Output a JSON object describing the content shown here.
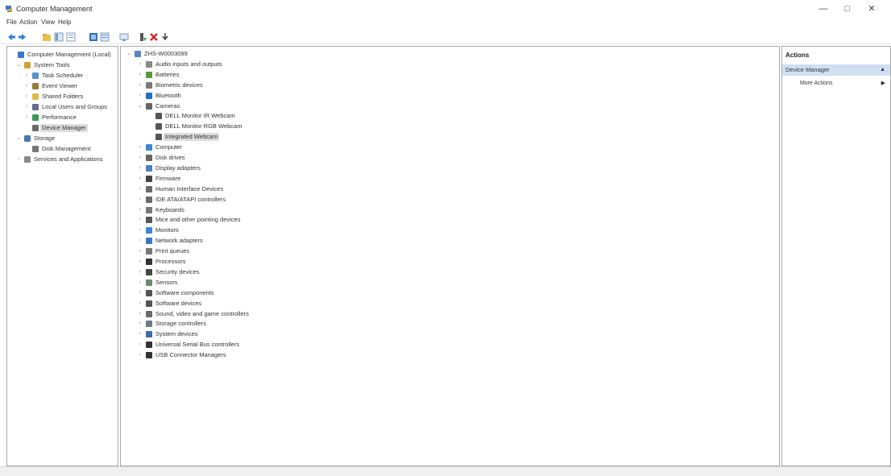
{
  "window": {
    "title": "Computer Management",
    "minimize": "—",
    "maximize": "□",
    "close": "✕"
  },
  "menu": [
    "File",
    "Action",
    "View",
    "Help"
  ],
  "left_tree": [
    {
      "label": "Computer Management (Local)",
      "icon": "computer-management-icon",
      "expander": ""
    },
    {
      "label": "System Tools",
      "icon": "tools-icon",
      "expander": "⌄"
    },
    {
      "label": "Task Scheduler",
      "icon": "clock-icon",
      "expander": "›"
    },
    {
      "label": "Event Viewer",
      "icon": "event-viewer-icon",
      "expander": "›"
    },
    {
      "label": "Shared Folders",
      "icon": "shared-folder-icon",
      "expander": "›"
    },
    {
      "label": "Local Users and Groups",
      "icon": "users-icon",
      "expander": "›"
    },
    {
      "label": "Performance",
      "icon": "performance-icon",
      "expander": "›"
    },
    {
      "label": "Device Manager",
      "icon": "device-manager-icon",
      "expander": "",
      "selected": true
    },
    {
      "label": "Storage",
      "icon": "storage-icon",
      "expander": "⌄"
    },
    {
      "label": "Disk Management",
      "icon": "disk-icon",
      "expander": ""
    },
    {
      "label": "Services and Applications",
      "icon": "services-icon",
      "expander": "›"
    }
  ],
  "device_tree": [
    {
      "label": "ZHS-W0003099",
      "icon": "computer-icon",
      "expander": "⌄"
    },
    {
      "label": "Audio inputs and outputs",
      "icon": "audio-icon",
      "expander": "›"
    },
    {
      "label": "Batteries",
      "icon": "battery-icon",
      "expander": "›"
    },
    {
      "label": "Biometric devices",
      "icon": "biometric-icon",
      "expander": "›"
    },
    {
      "label": "Bluetooth",
      "icon": "bluetooth-icon",
      "expander": "›"
    },
    {
      "label": "Cameras",
      "icon": "camera-icon",
      "expander": "⌄"
    },
    {
      "label": "DELL Monitor IR Webcam",
      "icon": "webcam-icon",
      "expander": ""
    },
    {
      "label": "DELL Monitor RGB Webcam",
      "icon": "webcam-icon",
      "expander": ""
    },
    {
      "label": "Integrated Webcam",
      "icon": "webcam-icon",
      "expander": "",
      "selected": true
    },
    {
      "label": "Computer",
      "icon": "monitor-icon",
      "expander": "›"
    },
    {
      "label": "Disk drives",
      "icon": "disk-drive-icon",
      "expander": "›"
    },
    {
      "label": "Display adapters",
      "icon": "display-adapter-icon",
      "expander": "›"
    },
    {
      "label": "Firmware",
      "icon": "firmware-icon",
      "expander": "›"
    },
    {
      "label": "Human Interface Devices",
      "icon": "hid-icon",
      "expander": "›"
    },
    {
      "label": "IDE ATA/ATAPI controllers",
      "icon": "ide-icon",
      "expander": "›"
    },
    {
      "label": "Keyboards",
      "icon": "keyboard-icon",
      "expander": "›"
    },
    {
      "label": "Mice and other pointing devices",
      "icon": "mouse-icon",
      "expander": "›"
    },
    {
      "label": "Monitors",
      "icon": "monitor-icon",
      "expander": "›"
    },
    {
      "label": "Network adapters",
      "icon": "network-icon",
      "expander": "›"
    },
    {
      "label": "Print queues",
      "icon": "printer-icon",
      "expander": "›"
    },
    {
      "label": "Processors",
      "icon": "processor-icon",
      "expander": "›"
    },
    {
      "label": "Security devices",
      "icon": "security-icon",
      "expander": "›"
    },
    {
      "label": "Sensors",
      "icon": "sensor-icon",
      "expander": "›"
    },
    {
      "label": "Software components",
      "icon": "software-component-icon",
      "expander": "›"
    },
    {
      "label": "Software devices",
      "icon": "software-device-icon",
      "expander": "›"
    },
    {
      "label": "Sound, video and game controllers",
      "icon": "sound-icon",
      "expander": "›"
    },
    {
      "label": "Storage controllers",
      "icon": "storage-controller-icon",
      "expander": "›"
    },
    {
      "label": "System devices",
      "icon": "system-device-icon",
      "expander": "›"
    },
    {
      "label": "Universal Serial Bus controllers",
      "icon": "usb-icon",
      "expander": "›"
    },
    {
      "label": "USB Connector Managers",
      "icon": "usb-icon",
      "expander": "›"
    }
  ],
  "actions": {
    "header": "Actions",
    "section": "Device Manager",
    "section_arrow": "▲",
    "more": "More Actions",
    "more_arrow": "▶"
  },
  "colors": {
    "selection": "#cfe0f2",
    "border": "#a9a9a9"
  }
}
